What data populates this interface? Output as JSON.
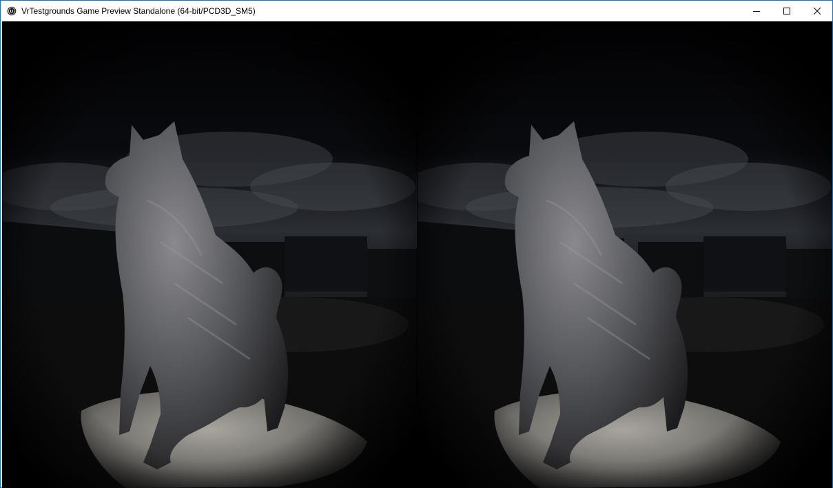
{
  "window": {
    "title": "VrTestgrounds Game Preview Standalone (64-bit/PCD3D_SM5)",
    "app_icon": "unreal-engine-logo-icon",
    "controls": [
      {
        "name": "minimize-button",
        "icon": "minimize-icon"
      },
      {
        "name": "maximize-button",
        "icon": "maximize-icon"
      },
      {
        "name": "close-button",
        "icon": "close-icon"
      }
    ]
  },
  "viewport": {
    "mode": "stereo-vr-preview",
    "eyes": [
      "left",
      "right"
    ],
    "scene": "stone-dog-statue-night-sky"
  }
}
